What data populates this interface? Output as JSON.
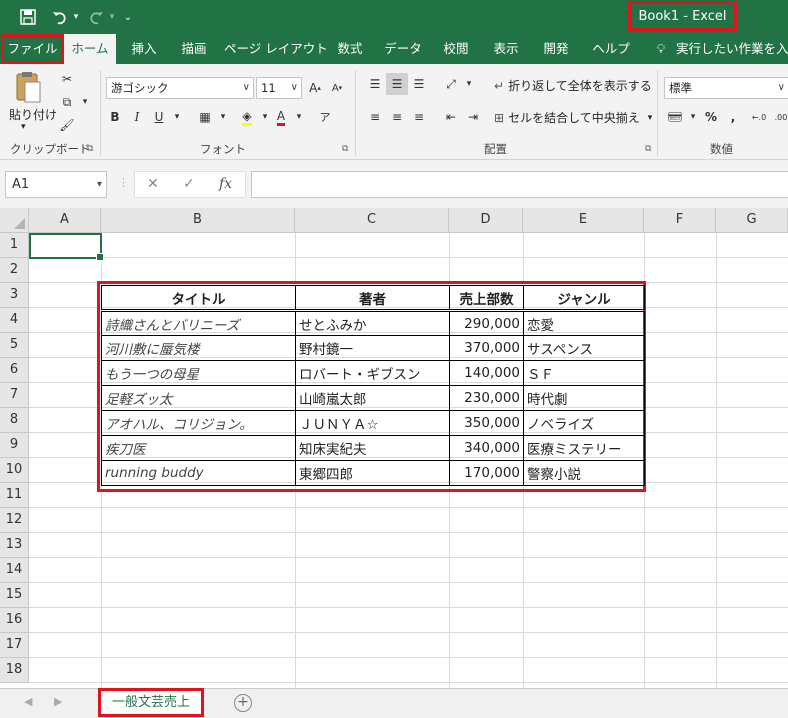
{
  "titlebar": {
    "title": "Book1  -  Excel",
    "qat_icons": [
      "save-icon",
      "undo-icon",
      "redo-icon",
      "customize-icon"
    ]
  },
  "tabs": [
    {
      "label": "ファイル"
    },
    {
      "label": "ホーム"
    },
    {
      "label": "挿入"
    },
    {
      "label": "描画"
    },
    {
      "label": "ページ レイアウト"
    },
    {
      "label": "数式"
    },
    {
      "label": "データ"
    },
    {
      "label": "校閲"
    },
    {
      "label": "表示"
    },
    {
      "label": "開発"
    },
    {
      "label": "ヘルプ"
    },
    {
      "label": "実行したい作業を入力"
    }
  ],
  "ribbon": {
    "clipboard": {
      "paste_label": "貼り付け",
      "group_label": "クリップボード"
    },
    "font": {
      "font_name": "游ゴシック",
      "font_size": "11",
      "group_label": "フォント"
    },
    "alignment": {
      "wrap_label": "折り返して全体を表示する",
      "merge_label": "セルを結合して中央揃え",
      "group_label": "配置"
    },
    "number": {
      "format": "標準",
      "group_label": "数値"
    }
  },
  "formula_bar": {
    "name_box": "A1",
    "fx": "fx",
    "formula": ""
  },
  "columns": [
    "A",
    "B",
    "C",
    "D",
    "E",
    "F",
    "G"
  ],
  "rows": [
    "1",
    "2",
    "3",
    "4",
    "5",
    "6",
    "7",
    "8",
    "9",
    "10",
    "11",
    "12",
    "13",
    "14",
    "15",
    "16",
    "17",
    "18"
  ],
  "table": {
    "headers": [
      "タイトル",
      "著者",
      "売上部数",
      "ジャンル"
    ],
    "rows": [
      [
        "詩織さんとバリニーズ",
        "せとふみか",
        "290,000",
        "恋愛"
      ],
      [
        "河川敷に蜃気楼",
        "野村鏡一",
        "370,000",
        "サスペンス"
      ],
      [
        "もう一つの母星",
        "ロバート・ギブスン",
        "140,000",
        "ＳＦ"
      ],
      [
        "足軽ズッ太",
        "山崎嵐太郎",
        "230,000",
        "時代劇"
      ],
      [
        "アオハル、コリジョン。",
        "ＪＵＮＹＡ☆",
        "350,000",
        "ノベライズ"
      ],
      [
        "疾刀医",
        "知床実紀夫",
        "340,000",
        "医療ミステリー"
      ],
      [
        "running buddy",
        "東郷四郎",
        "170,000",
        "警察小説"
      ]
    ]
  },
  "sheet_tabs": [
    {
      "label": "一般文芸売上"
    }
  ],
  "colors": {
    "accent": "#217346",
    "highlight": "#e0141e"
  }
}
